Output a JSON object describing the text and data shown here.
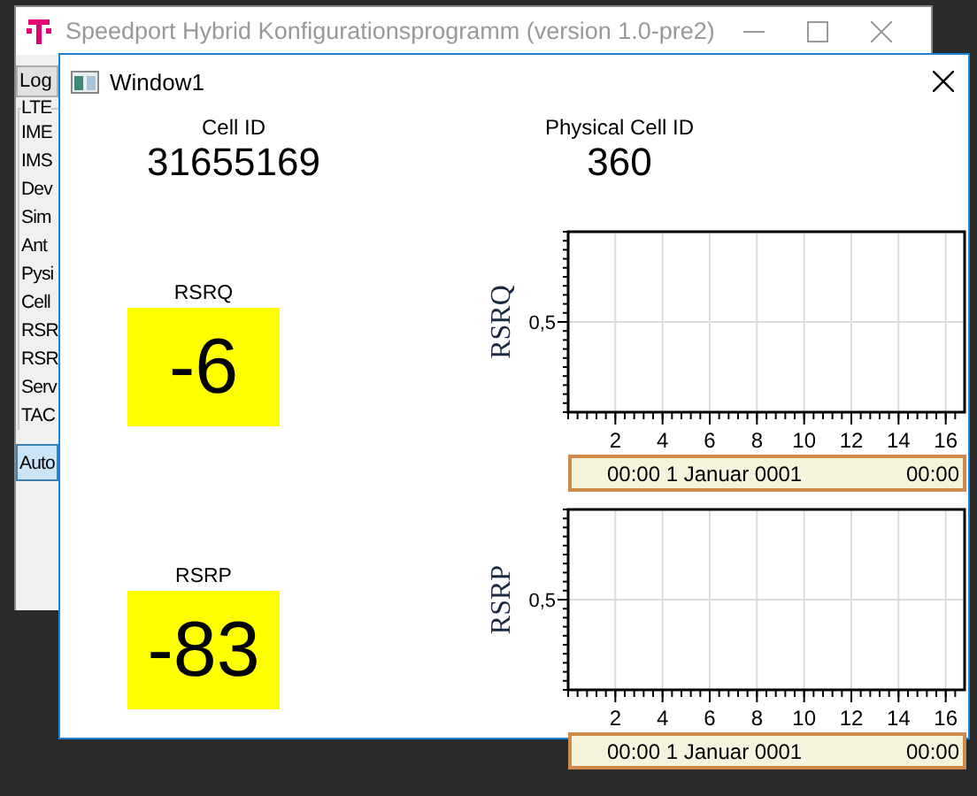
{
  "back_window": {
    "title": "Speedport Hybrid Konfigurationsprogramm (version 1.0-pre2)",
    "logo_button": "Log",
    "group_title": "LTE",
    "items": [
      "IME",
      "IMS",
      "Dev",
      "Sim",
      "Ant",
      "Pysi",
      "Cell",
      "RSR",
      "RSR",
      "Serv",
      "TAC"
    ],
    "auto_button": "Auto"
  },
  "window": {
    "title": "Window1",
    "fields": [
      {
        "label": "Cell ID",
        "value": "31655169"
      },
      {
        "label": "Physical Cell ID",
        "value": "360"
      }
    ],
    "meters": [
      {
        "label": "RSRQ",
        "value": "-6"
      },
      {
        "label": "RSRP",
        "value": "-83"
      }
    ],
    "charts": [
      {
        "axis_title": "RSRQ",
        "y_tick_labels": [
          "0,5"
        ],
        "x_tick_labels": [
          "2",
          "4",
          "6",
          "8",
          "10",
          "12",
          "14",
          "16"
        ],
        "time_labels": [
          "00:00 1 Januar 0001",
          "00:00"
        ]
      },
      {
        "axis_title": "RSRP",
        "y_tick_labels": [
          "0,5"
        ],
        "x_tick_labels": [
          "2",
          "4",
          "6",
          "8",
          "10",
          "12",
          "14",
          "16"
        ],
        "time_labels": [
          "00:00 1 Januar 0001",
          "00:00"
        ]
      }
    ]
  }
}
